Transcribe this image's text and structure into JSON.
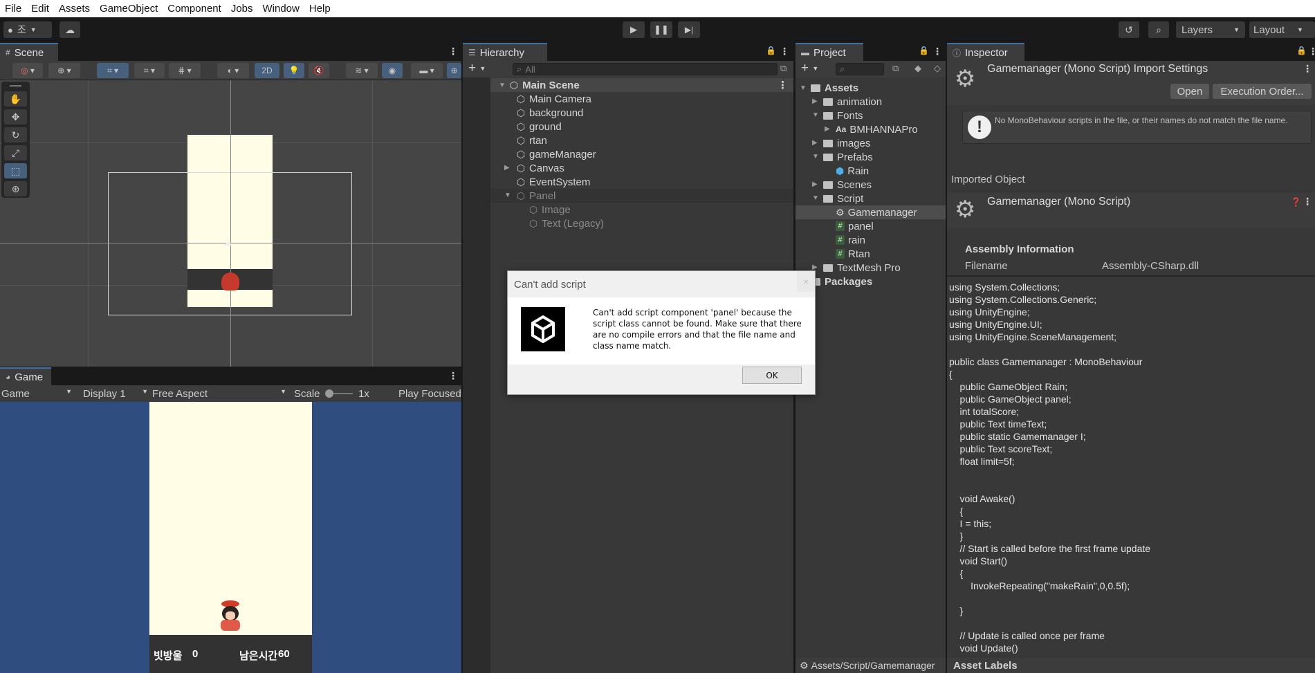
{
  "menu": [
    "File",
    "Edit",
    "Assets",
    "GameObject",
    "Component",
    "Jobs",
    "Window",
    "Help"
  ],
  "toolbar": {
    "account_label": "조",
    "layers_label": "Layers",
    "layout_label": "Layout"
  },
  "scene": {
    "tab_label": "Scene",
    "mode_2d": "2D"
  },
  "game": {
    "tab_label": "Game",
    "view_select": "Game",
    "display_select": "Display 1",
    "aspect_select": "Free Aspect",
    "scale_label": "Scale",
    "scale_value": "1x",
    "play_focused": "Play Focused",
    "hud_score_label": "빗방울",
    "hud_score_value": "0",
    "hud_time_label": "남은시간",
    "hud_time_value": "60"
  },
  "hierarchy": {
    "tab_label": "Hierarchy",
    "search_placeholder": "All",
    "scene_name": "Main Scene",
    "items": [
      {
        "label": "Main Camera"
      },
      {
        "label": "background"
      },
      {
        "label": "ground"
      },
      {
        "label": "rtan"
      },
      {
        "label": "gameManager"
      },
      {
        "label": "Canvas"
      },
      {
        "label": "EventSystem"
      },
      {
        "label": "Panel"
      },
      {
        "label": "Image"
      },
      {
        "label": "Text (Legacy)"
      }
    ]
  },
  "project": {
    "tab_label": "Project",
    "root": "Assets",
    "items": [
      {
        "label": "animation"
      },
      {
        "label": "Fonts"
      },
      {
        "label": "BMHANNAPro"
      },
      {
        "label": "images"
      },
      {
        "label": "Prefabs"
      },
      {
        "label": "Rain"
      },
      {
        "label": "Scenes"
      },
      {
        "label": "Script"
      },
      {
        "label": "Gamemanager"
      },
      {
        "label": "panel"
      },
      {
        "label": "rain"
      },
      {
        "label": "Rtan"
      },
      {
        "label": "TextMesh Pro"
      }
    ],
    "packages": "Packages",
    "status_path": "Assets/Script/Gamemanager"
  },
  "inspector": {
    "tab_label": "Inspector",
    "title": "Gamemanager (Mono Script) Import Settings",
    "open_button": "Open",
    "execution_order_button": "Execution Order...",
    "warning": "No MonoBehaviour scripts in the file, or their names do not match the file name.",
    "imported_object_label": "Imported Object",
    "object_title": "Gamemanager (Mono Script)",
    "assembly_header": "Assembly Information",
    "filename_label": "Filename",
    "filename_value": "Assembly-CSharp.dll",
    "asset_labels": "Asset Labels",
    "code": "using System.Collections;\nusing System.Collections.Generic;\nusing UnityEngine;\nusing UnityEngine.UI;\nusing UnityEngine.SceneManagement;\n\npublic class Gamemanager : MonoBehaviour\n{\n    public GameObject Rain;\n    public GameObject panel;\n    int totalScore;\n    public Text timeText;\n    public static Gamemanager I;\n    public Text scoreText;\n    float limit=5f;\n\n\n    void Awake()\n    {\n    I = this;\n    }\n    // Start is called before the first frame update\n    void Start()\n    {\n        InvokeRepeating(\"makeRain\",0,0.5f);\n\n    }\n\n    // Update is called once per frame\n    void Update()"
  },
  "dialog": {
    "title": "Can't add script",
    "message": "Can't add script component 'panel' because the script class cannot be found. Make sure that there are no compile errors and that the file name and class name match.",
    "ok": "OK",
    "close_glyph": "×"
  }
}
